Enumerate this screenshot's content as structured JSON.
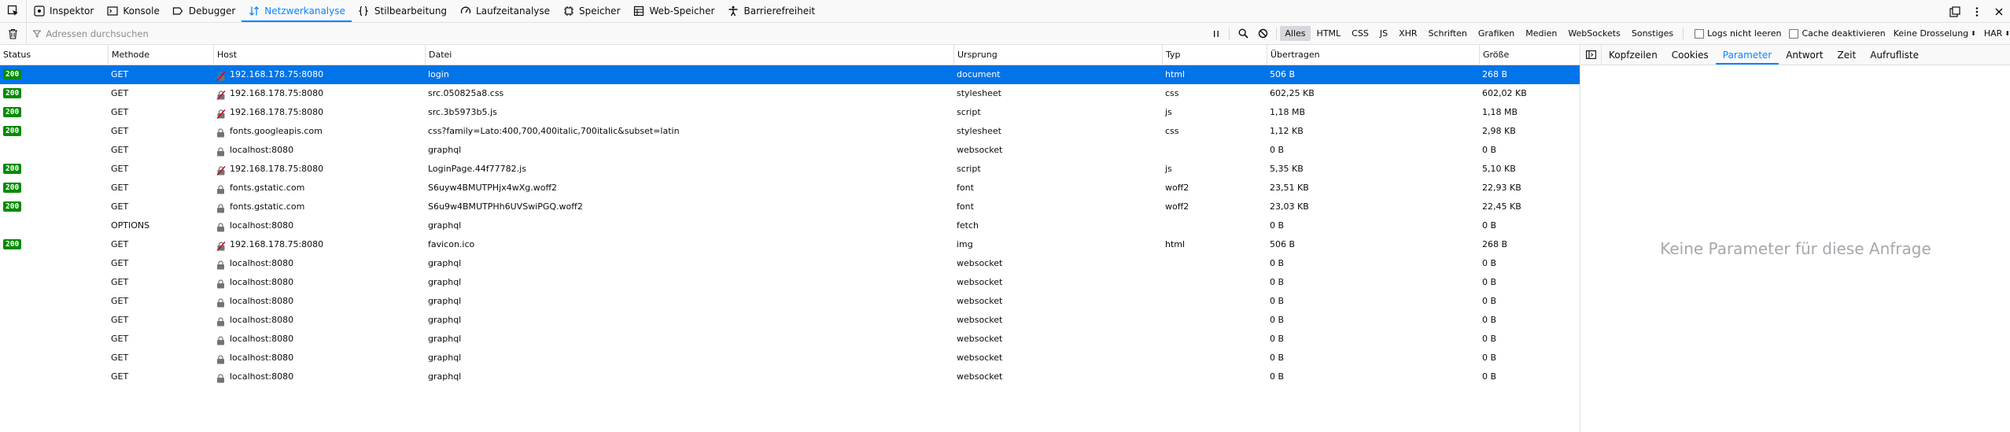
{
  "toolbar": {
    "tabs": [
      {
        "label": "Inspektor",
        "icon": "inspector-icon"
      },
      {
        "label": "Konsole",
        "icon": "console-icon"
      },
      {
        "label": "Debugger",
        "icon": "debugger-icon"
      },
      {
        "label": "Netzwerkanalyse",
        "icon": "network-icon",
        "active": true
      },
      {
        "label": "Stilbearbeitung",
        "icon": "style-editor-icon"
      },
      {
        "label": "Laufzeitanalyse",
        "icon": "performance-icon"
      },
      {
        "label": "Speicher",
        "icon": "memory-icon"
      },
      {
        "label": "Web-Speicher",
        "icon": "storage-icon"
      },
      {
        "label": "Barrierefreiheit",
        "icon": "accessibility-icon"
      }
    ],
    "accent": "#0a84ff"
  },
  "filterbar": {
    "search_placeholder": "Adressen durchsuchen",
    "types": [
      "Alles",
      "HTML",
      "CSS",
      "JS",
      "XHR",
      "Schriften",
      "Grafiken",
      "Medien",
      "WebSockets",
      "Sonstiges"
    ],
    "active_type": "Alles",
    "persist_logs_label": "Logs nicht leeren",
    "disable_cache_label": "Cache deaktivieren",
    "throttling_label": "Keine Drosselung",
    "har_label": "HAR"
  },
  "table": {
    "columns": [
      "Status",
      "Methode",
      "Host",
      "Datei",
      "Ursprung",
      "Typ",
      "Übertragen",
      "Größe"
    ],
    "status_color": "#058b00",
    "selected_color": "#0074e8",
    "rows": [
      {
        "status": "200",
        "method": "GET",
        "host": "192.168.178.75:8080",
        "host_icon": "insecure",
        "file": "login",
        "cause": "document",
        "type": "html",
        "transferred": "506 B",
        "size": "268 B",
        "selected": true
      },
      {
        "status": "200",
        "method": "GET",
        "host": "192.168.178.75:8080",
        "host_icon": "insecure",
        "file": "src.050825a8.css",
        "cause": "stylesheet",
        "type": "css",
        "transferred": "602,25 KB",
        "size": "602,02 KB"
      },
      {
        "status": "200",
        "method": "GET",
        "host": "192.168.178.75:8080",
        "host_icon": "insecure",
        "file": "src.3b5973b5.js",
        "cause": "script",
        "type": "js",
        "transferred": "1,18 MB",
        "size": "1,18 MB"
      },
      {
        "status": "200",
        "method": "GET",
        "host": "fonts.googleapis.com",
        "host_icon": "secure",
        "file": "css?family=Lato:400,700,400italic,700italic&subset=latin",
        "cause": "stylesheet",
        "type": "css",
        "transferred": "1,12 KB",
        "size": "2,98 KB"
      },
      {
        "status": "",
        "method": "GET",
        "host": "localhost:8080",
        "host_icon": "secure",
        "file": "graphql",
        "cause": "websocket",
        "type": "",
        "transferred": "0 B",
        "size": "0 B"
      },
      {
        "status": "200",
        "method": "GET",
        "host": "192.168.178.75:8080",
        "host_icon": "insecure",
        "file": "LoginPage.44f77782.js",
        "cause": "script",
        "type": "js",
        "transferred": "5,35 KB",
        "size": "5,10 KB"
      },
      {
        "status": "200",
        "method": "GET",
        "host": "fonts.gstatic.com",
        "host_icon": "secure",
        "file": "S6uyw4BMUTPHjx4wXg.woff2",
        "cause": "font",
        "type": "woff2",
        "transferred": "23,51 KB",
        "size": "22,93 KB"
      },
      {
        "status": "200",
        "method": "GET",
        "host": "fonts.gstatic.com",
        "host_icon": "secure",
        "file": "S6u9w4BMUTPHh6UVSwiPGQ.woff2",
        "cause": "font",
        "type": "woff2",
        "transferred": "23,03 KB",
        "size": "22,45 KB"
      },
      {
        "status": "",
        "method": "OPTIONS",
        "host": "localhost:8080",
        "host_icon": "secure",
        "file": "graphql",
        "cause": "fetch",
        "type": "",
        "transferred": "0 B",
        "size": "0 B"
      },
      {
        "status": "200",
        "method": "GET",
        "host": "192.168.178.75:8080",
        "host_icon": "insecure",
        "file": "favicon.ico",
        "cause": "img",
        "type": "html",
        "transferred": "506 B",
        "size": "268 B"
      },
      {
        "status": "",
        "method": "GET",
        "host": "localhost:8080",
        "host_icon": "secure",
        "file": "graphql",
        "cause": "websocket",
        "type": "",
        "transferred": "0 B",
        "size": "0 B"
      },
      {
        "status": "",
        "method": "GET",
        "host": "localhost:8080",
        "host_icon": "secure",
        "file": "graphql",
        "cause": "websocket",
        "type": "",
        "transferred": "0 B",
        "size": "0 B"
      },
      {
        "status": "",
        "method": "GET",
        "host": "localhost:8080",
        "host_icon": "secure",
        "file": "graphql",
        "cause": "websocket",
        "type": "",
        "transferred": "0 B",
        "size": "0 B"
      },
      {
        "status": "",
        "method": "GET",
        "host": "localhost:8080",
        "host_icon": "secure",
        "file": "graphql",
        "cause": "websocket",
        "type": "",
        "transferred": "0 B",
        "size": "0 B"
      },
      {
        "status": "",
        "method": "GET",
        "host": "localhost:8080",
        "host_icon": "secure",
        "file": "graphql",
        "cause": "websocket",
        "type": "",
        "transferred": "0 B",
        "size": "0 B"
      },
      {
        "status": "",
        "method": "GET",
        "host": "localhost:8080",
        "host_icon": "secure",
        "file": "graphql",
        "cause": "websocket",
        "type": "",
        "transferred": "0 B",
        "size": "0 B"
      },
      {
        "status": "",
        "method": "GET",
        "host": "localhost:8080",
        "host_icon": "secure",
        "file": "graphql",
        "cause": "websocket",
        "type": "",
        "transferred": "0 B",
        "size": "0 B"
      }
    ]
  },
  "sidebar": {
    "tabs": [
      "Kopfzeilen",
      "Cookies",
      "Parameter",
      "Antwort",
      "Zeit",
      "Aufrufliste"
    ],
    "active_tab": "Parameter",
    "empty_message": "Keine Parameter für diese Anfrage"
  }
}
